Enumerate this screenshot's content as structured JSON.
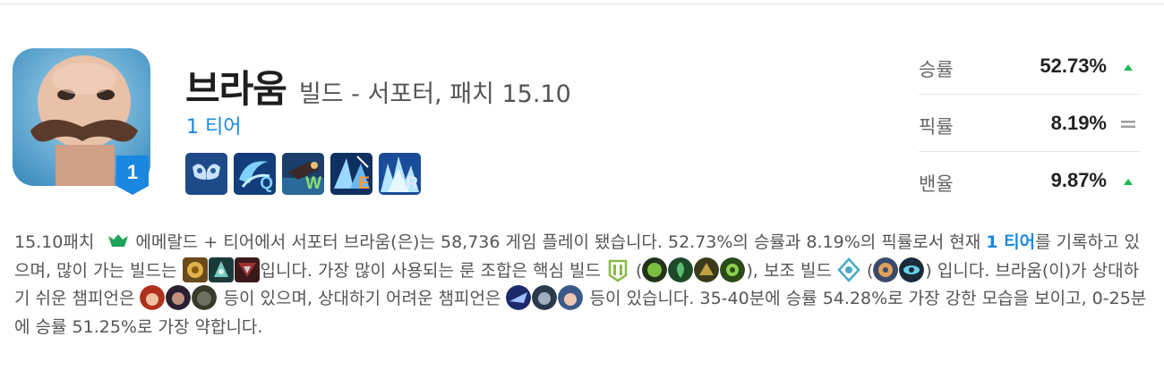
{
  "champion": {
    "name": "브라움",
    "subtitle": "빌드 - 서포터, 패치 15.10",
    "tier_link": "1 티어",
    "tier_badge": "1"
  },
  "skills": [
    {
      "icon": "passive-icon",
      "key": ""
    },
    {
      "icon": "skill-q-icon",
      "key": "Q"
    },
    {
      "icon": "skill-w-icon",
      "key": "W"
    },
    {
      "icon": "skill-e-icon",
      "key": "E"
    },
    {
      "icon": "skill-r-icon",
      "key": "R"
    }
  ],
  "stats": [
    {
      "label": "승률",
      "value": "52.73%",
      "trend": "up"
    },
    {
      "label": "픽률",
      "value": "8.19%",
      "trend": "same"
    },
    {
      "label": "밴율",
      "value": "9.87%",
      "trend": "up"
    }
  ],
  "colors": {
    "accent": "#1a87e0",
    "trend_up": "#1db954",
    "trend_same": "#9e9e9e",
    "emerald": "#1fa35a"
  },
  "description": {
    "t1": "15.10패치",
    "t2": "에메랄드 + 티어에서 서포터 브라움(은)는 58,736 게임 플레이 됐습니다. 52.73%의 승률과 8.19%의 픽률로서 현재 ",
    "t2_highlight": "1 티어",
    "t3": "를 기록하고 있으며, 많이 가는 빌드는 ",
    "t4": "입니다. 가장 많이 사용되는 룬 조합은 핵심 빌드 ",
    "t5": " (",
    "t6": "), 보조 빌드 ",
    "t7": " (",
    "t8": ") 입니다. 브라움(이)가 상대하기 쉬운 챔피언은 ",
    "t9": " 등이 있으며, 상대하기 어려운 챔피언은 ",
    "t10": " 등이 있습니다. 35-40분에 승률 54.28%로 가장 강한 모습을 보이고, 0-25분에 승률 51.25%로 가장 약합니다."
  }
}
